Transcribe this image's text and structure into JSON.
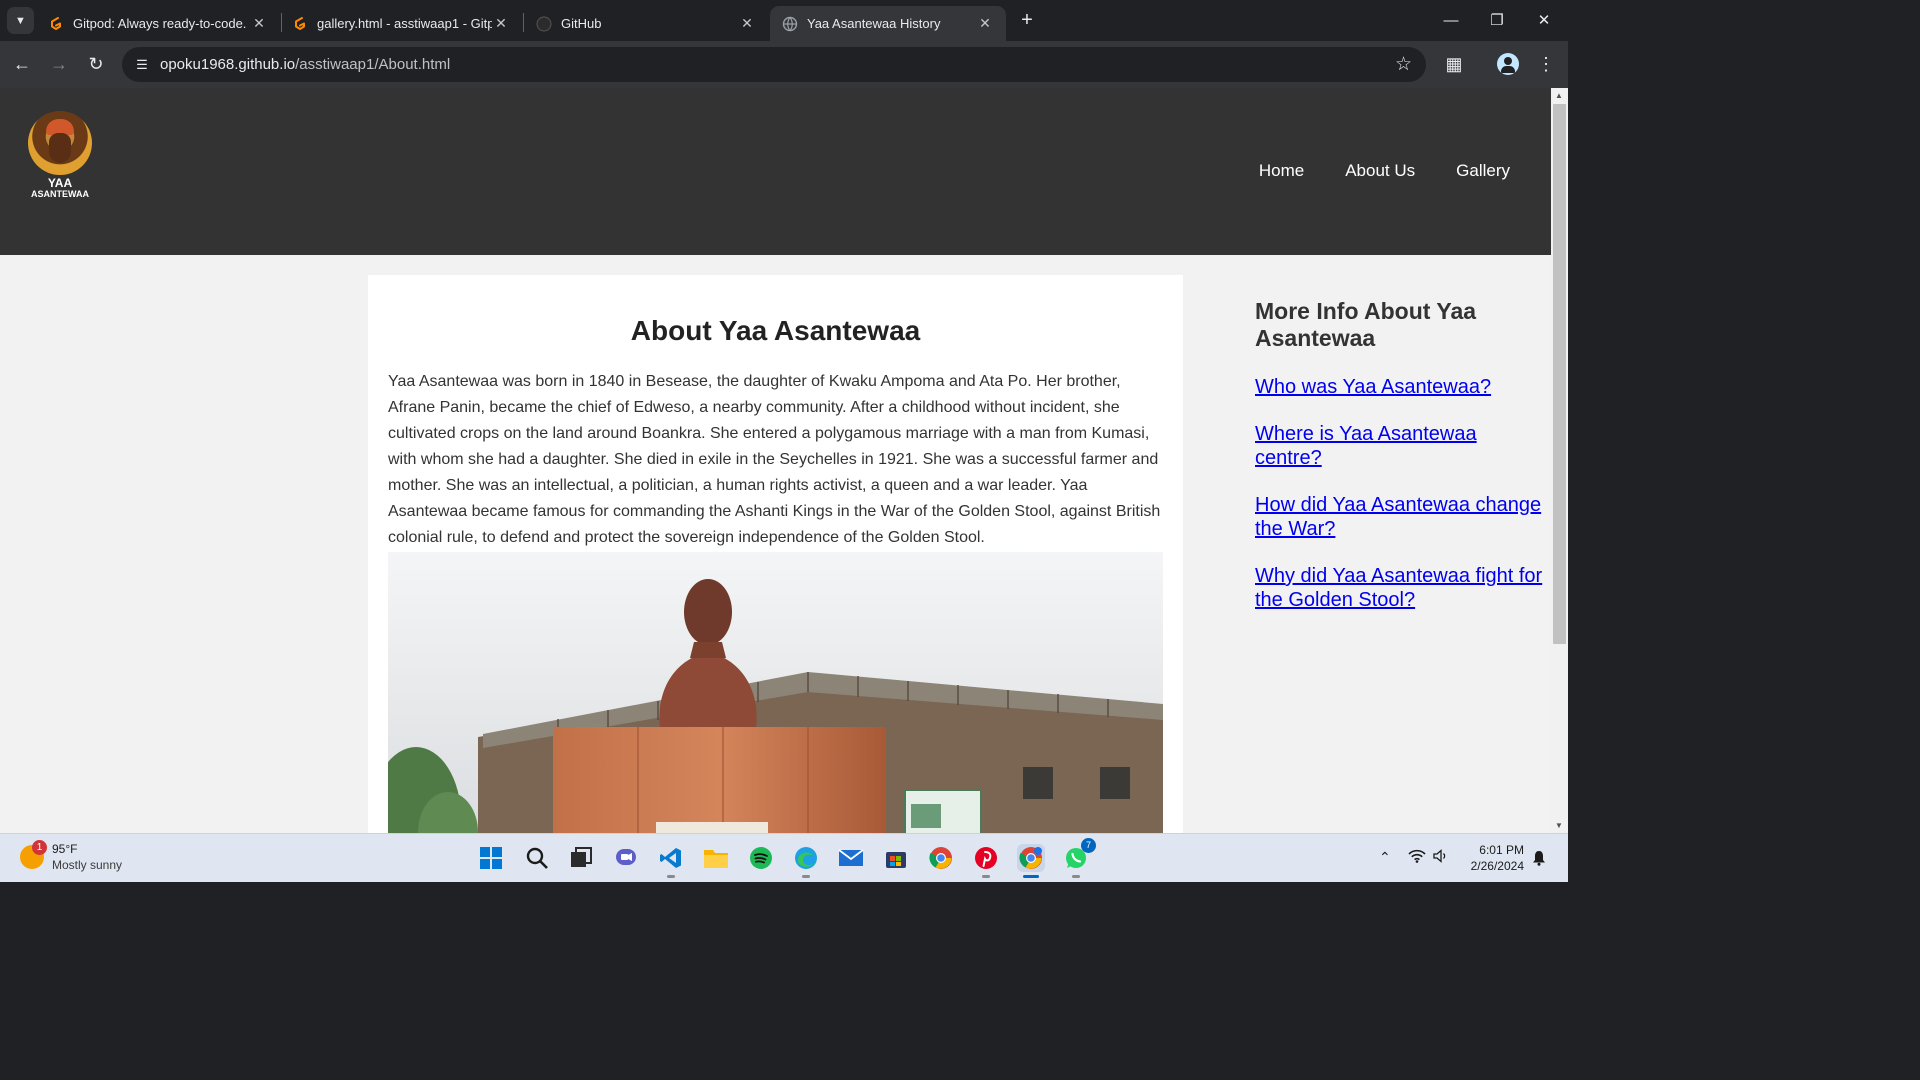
{
  "browser": {
    "tabs": [
      {
        "title": "Gitpod: Always ready-to-code.",
        "icon": "gitpod-icon",
        "active": false
      },
      {
        "title": "gallery.html - asstiwaap1 - Gitpod",
        "icon": "gitpod-icon",
        "active": false
      },
      {
        "title": "GitHub",
        "icon": "github-icon",
        "active": false
      },
      {
        "title": "Yaa Asantewaa History",
        "icon": "globe-icon",
        "active": true
      }
    ],
    "url_host": "opoku1968.github.io",
    "url_path": "/asstiwaap1/About.html"
  },
  "site": {
    "logo_line1": "YAA",
    "logo_line2": "ASANTEWAA",
    "nav": [
      "Home",
      "About Us",
      "Gallery"
    ]
  },
  "content": {
    "title": "About Yaa Asantewaa",
    "body": "Yaa Asantewaa was born in 1840 in Besease, the daughter of Kwaku Ampoma and Ata Po. Her brother, Afrane Panin, became the chief of Edweso, a nearby community. After a childhood without incident, she cultivated crops on the land around Boankra. She entered a polygamous marriage with a man from Kumasi, with whom she had a daughter. She died in exile in the Seychelles in 1921. She was a successful farmer and mother. She was an intellectual, a politician, a human rights activist, a queen and a war leader. Yaa Asantewaa became famous for commanding the Ashanti Kings in the War of the Golden Stool, against British colonial rule, to defend and protect the sovereign independence of the Golden Stool."
  },
  "sidebar": {
    "title": "More Info About Yaa Asantewaa",
    "links": [
      "Who was Yaa Asantewaa?",
      "Where is Yaa Asantewaa centre?",
      "How did Yaa Asantewaa change the War?",
      "Why did Yaa Asantewaa fight for the Golden Stool?"
    ]
  },
  "taskbar": {
    "weather_temp": "95°F",
    "weather_desc": "Mostly sunny",
    "weather_badge": "1",
    "whatsapp_badge": "7",
    "time": "6:01 PM",
    "date": "2/26/2024"
  },
  "colors": {
    "header_bg": "#333333",
    "link": "#0000ee",
    "page_bg": "#f2f2f2"
  }
}
